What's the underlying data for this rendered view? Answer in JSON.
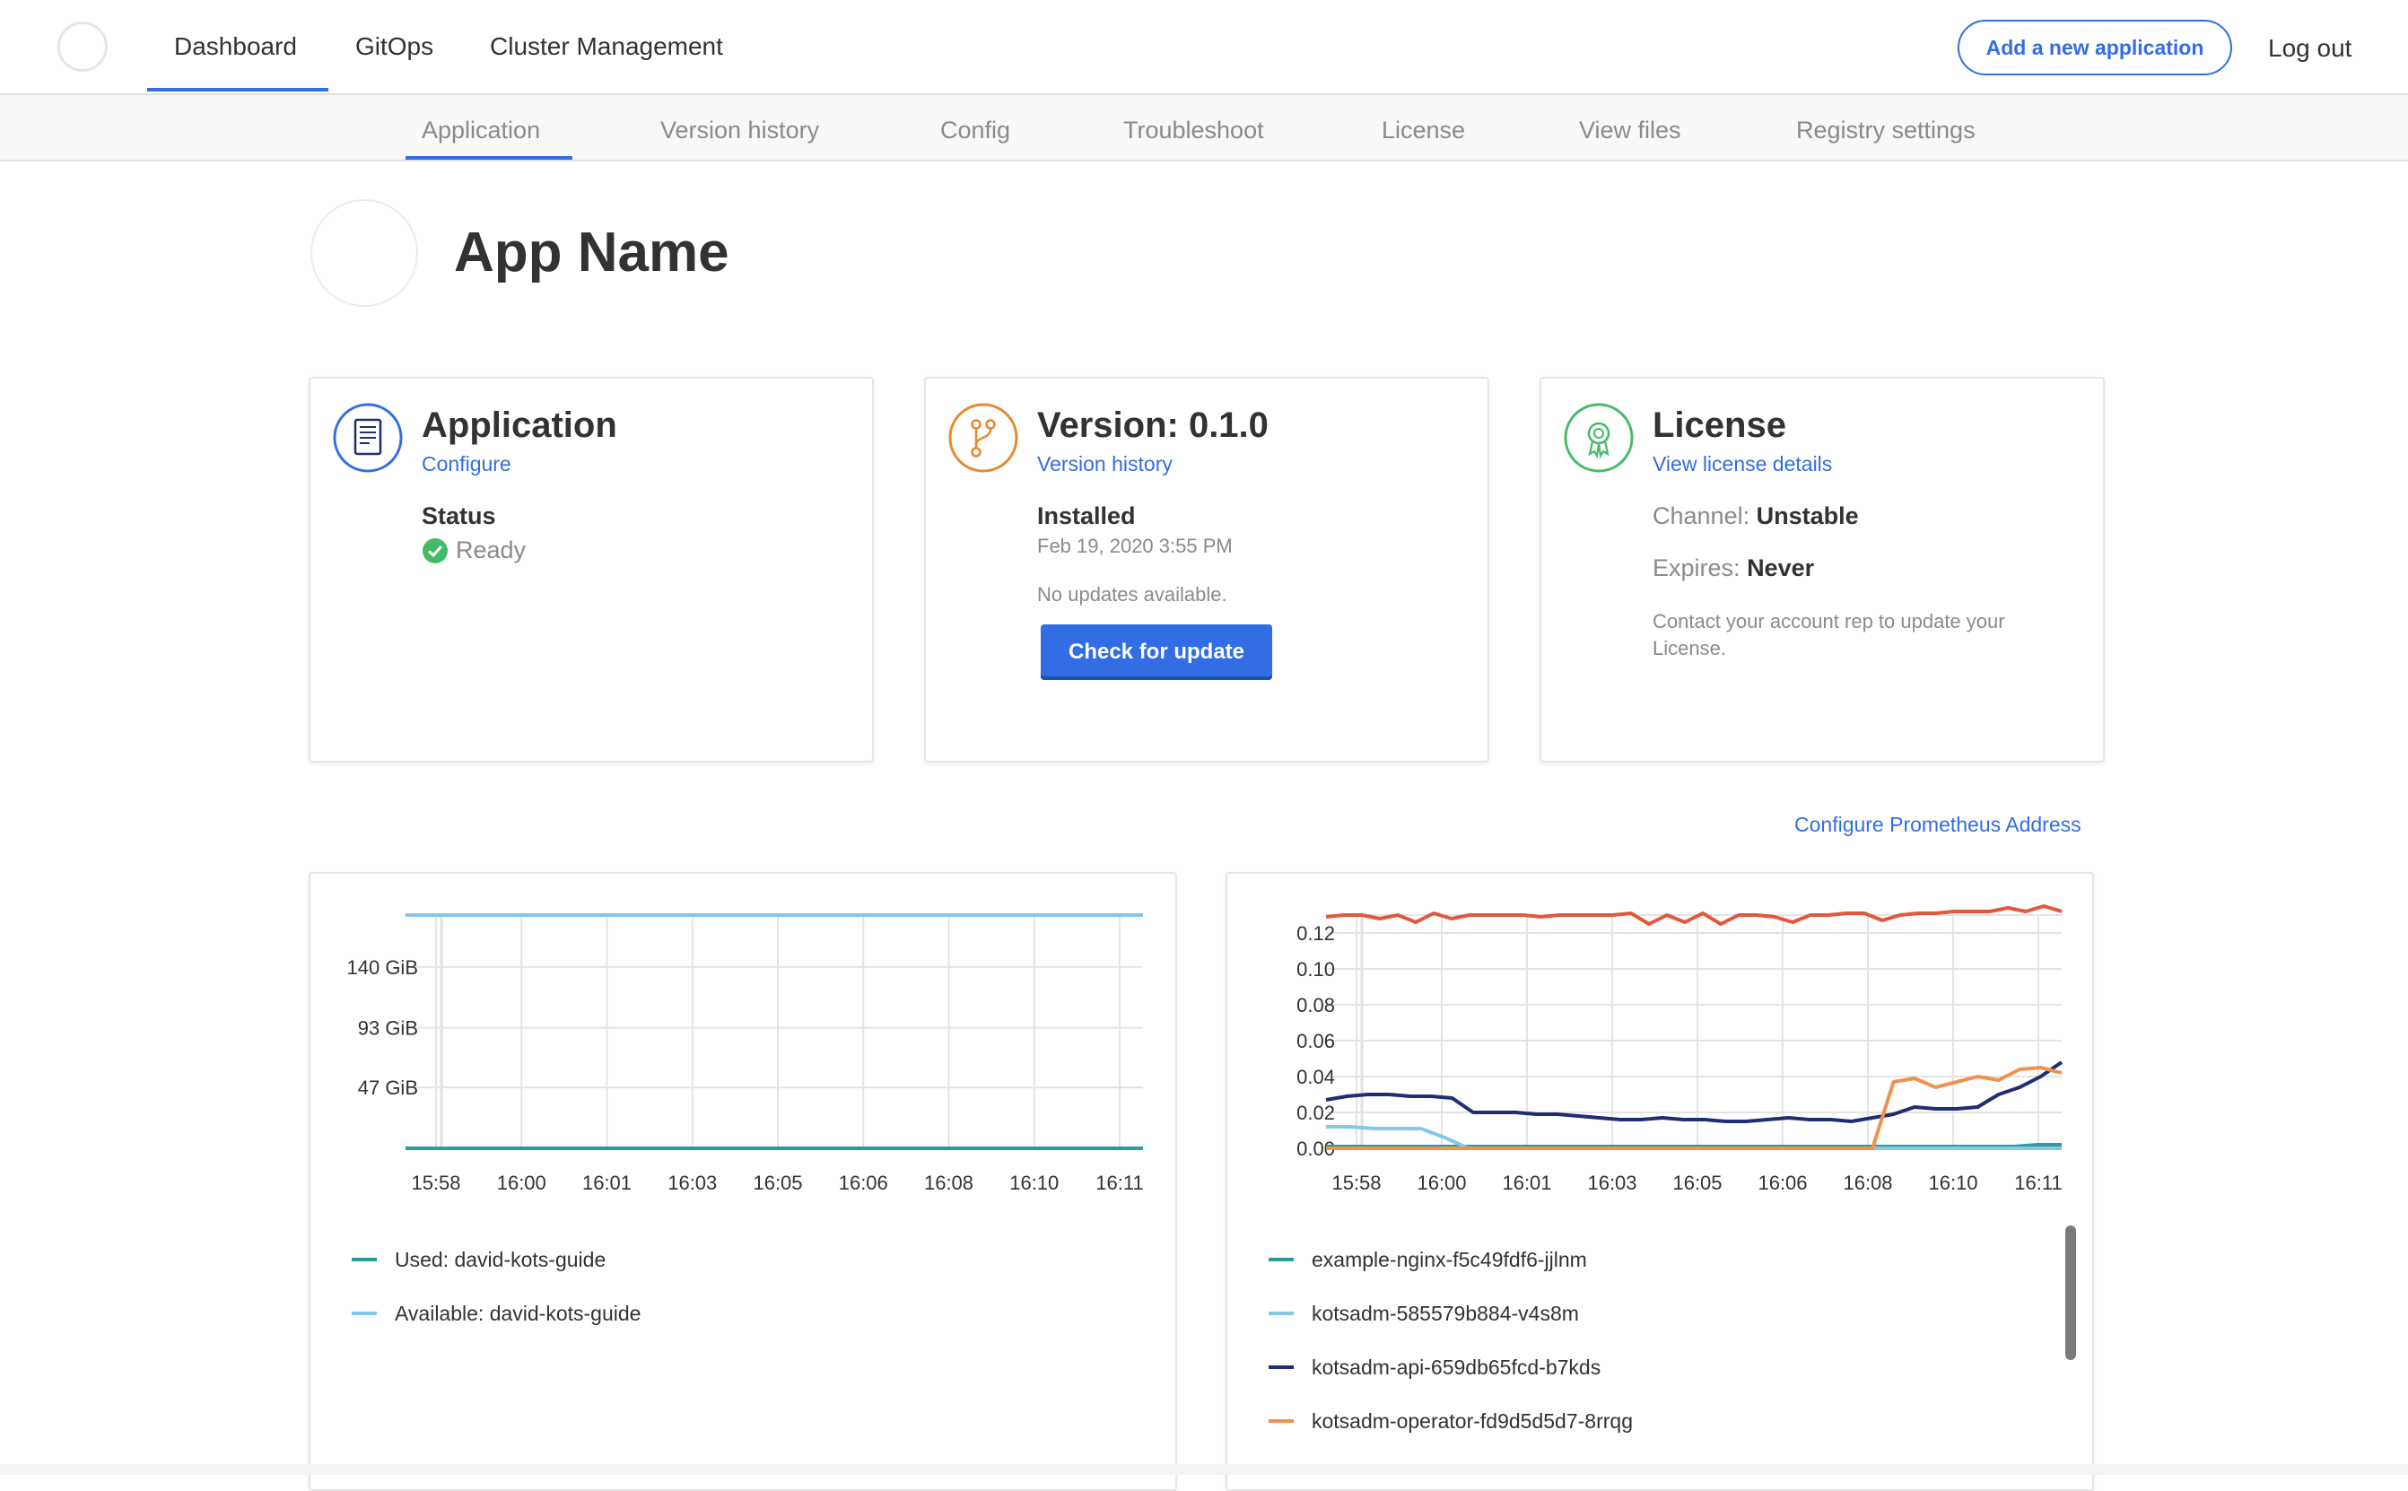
{
  "nav": {
    "items": [
      "Dashboard",
      "GitOps",
      "Cluster Management"
    ],
    "add_app": "Add a new application",
    "logout": "Log out"
  },
  "subnav": {
    "items": [
      "Application",
      "Version history",
      "Config",
      "Troubleshoot",
      "License",
      "View files",
      "Registry settings"
    ]
  },
  "app": {
    "name": "App Name"
  },
  "cards": {
    "application": {
      "title": "Application",
      "link": "Configure",
      "status_label": "Status",
      "status_value": "Ready",
      "icon": "document-icon"
    },
    "version": {
      "title": "Version: 0.1.0",
      "link": "Version history",
      "installed_label": "Installed",
      "installed_date": "Feb 19, 2020 3:55 PM",
      "updates": "No updates available.",
      "button": "Check for update",
      "icon": "git-branch-icon"
    },
    "license": {
      "title": "License",
      "link": "View license details",
      "channel_label": "Channel:",
      "channel_value": "Unstable",
      "expires_label": "Expires:",
      "expires_value": "Never",
      "note": "Contact your account rep to update your License.",
      "icon": "award-ribbon-icon"
    }
  },
  "prometheus_link": "Configure Prometheus Address",
  "colors": {
    "accent": "#326de6",
    "status_ready": "#44bb66",
    "version_icon": "#e6892d",
    "license_icon": "#44bb66"
  },
  "chart_data": [
    {
      "type": "line",
      "x": [
        "15:58",
        "16:00",
        "16:01",
        "16:03",
        "16:05",
        "16:06",
        "16:08",
        "16:10",
        "16:11"
      ],
      "yticks": [
        "47 GiB",
        "93 GiB",
        "140 GiB"
      ],
      "ylim": [
        0,
        180
      ],
      "grid": true,
      "legend_position": "bottom",
      "series": [
        {
          "name": "Used: david-kots-guide",
          "color": "#2b9b9b",
          "values": [
            0,
            0,
            0,
            0,
            0,
            0,
            0,
            0,
            0,
            0
          ]
        },
        {
          "name": "Available: david-kots-guide",
          "color": "#85c7e8",
          "values": [
            180,
            180,
            180,
            180,
            180,
            180,
            180,
            180,
            180,
            180
          ]
        }
      ]
    },
    {
      "type": "line",
      "x": [
        "15:58",
        "16:00",
        "16:01",
        "16:03",
        "16:05",
        "16:06",
        "16:08",
        "16:10",
        "16:11"
      ],
      "yticks": [
        "0.00",
        "0.02",
        "0.04",
        "0.06",
        "0.08",
        "0.10",
        "0.12"
      ],
      "ylim": [
        0,
        0.13
      ],
      "grid": true,
      "legend_position": "bottom",
      "series": [
        {
          "name": "example-nginx-f5c49fdf6-jjlnm",
          "color": "#2b9b9b",
          "values": [
            0.001,
            0.001,
            0.001,
            0.001,
            0.001,
            0.001,
            0.001,
            0.001,
            0.001,
            0.001,
            0.001,
            0.001,
            0.001,
            0.001,
            0.001,
            0.001,
            0.001,
            0.001,
            0.001,
            0.001,
            0.001,
            0.001,
            0.001,
            0.001,
            0.001,
            0.001,
            0.001,
            0.001,
            0.001,
            0.001,
            0.002,
            0.002
          ]
        },
        {
          "name": "kotsadm-585579b884-v4s8m",
          "color": "#85c7e8",
          "values": [
            0.012,
            0.012,
            0.011,
            0.011,
            0.011,
            0.006,
            0.0,
            0.0,
            0.0,
            0.0,
            0.0,
            0.0,
            0.0,
            0.0,
            0.0,
            0.0,
            0.0,
            0.0,
            0.0,
            0.0,
            0.0,
            0.0,
            0.0,
            0.0,
            0.0,
            0.0,
            0.0,
            0.0,
            0.0,
            0.0,
            0.0,
            0.0
          ]
        },
        {
          "name": "kotsadm-api-659db65fcd-b7kds",
          "color": "#1f2d73",
          "values": [
            0.027,
            0.029,
            0.03,
            0.03,
            0.029,
            0.029,
            0.028,
            0.02,
            0.02,
            0.02,
            0.019,
            0.019,
            0.018,
            0.017,
            0.016,
            0.016,
            0.017,
            0.016,
            0.016,
            0.015,
            0.015,
            0.016,
            0.017,
            0.016,
            0.016,
            0.015,
            0.017,
            0.019,
            0.023,
            0.022,
            0.022,
            0.023,
            0.03,
            0.034,
            0.04,
            0.048
          ]
        },
        {
          "name": "kotsadm-operator-fd9d5d5d7-8rrqg",
          "color": "#f0924e",
          "values": [
            0,
            0,
            0,
            0,
            0,
            0,
            0,
            0,
            0,
            0,
            0,
            0,
            0,
            0,
            0,
            0,
            0,
            0,
            0,
            0,
            0,
            0,
            0,
            0,
            0,
            0,
            0.0,
            0.037,
            0.039,
            0.034,
            0.037,
            0.04,
            0.038,
            0.044,
            0.045,
            0.042
          ]
        },
        {
          "name": "",
          "color": "#e2583a",
          "values": [
            0.129,
            0.13,
            0.13,
            0.128,
            0.13,
            0.126,
            0.131,
            0.128,
            0.13,
            0.13,
            0.13,
            0.13,
            0.129,
            0.13,
            0.13,
            0.13,
            0.13,
            0.131,
            0.125,
            0.13,
            0.126,
            0.131,
            0.125,
            0.13,
            0.13,
            0.129,
            0.126,
            0.13,
            0.13,
            0.131,
            0.131,
            0.127,
            0.13,
            0.131,
            0.131,
            0.132,
            0.132,
            0.132,
            0.134,
            0.132,
            0.135,
            0.132
          ]
        }
      ]
    }
  ]
}
